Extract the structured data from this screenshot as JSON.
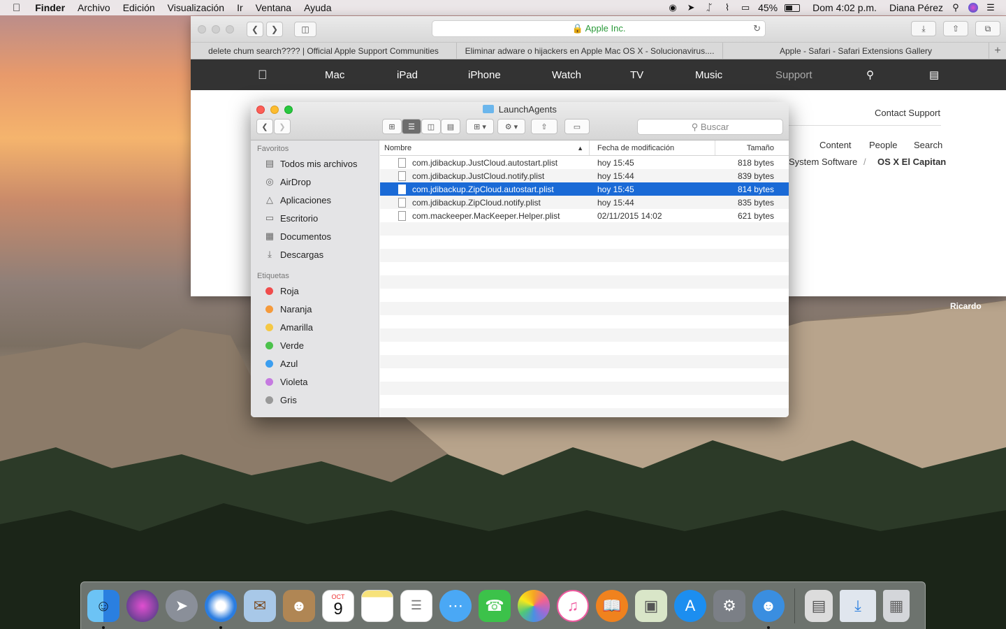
{
  "menubar": {
    "apple_icon": "apple-logo",
    "app": "Finder",
    "items": [
      "Archivo",
      "Edición",
      "Visualización",
      "Ir",
      "Ventana",
      "Ayuda"
    ],
    "battery": "45%",
    "clock": "Dom 4:02 p.m.",
    "user": "Diana Pérez"
  },
  "safari": {
    "address": "Apple Inc.",
    "tabs": [
      "delete chum search???? | Official Apple Support Communities",
      "Eliminar adware o hijackers en Apple Mac OS X - Solucionavirus....",
      "Apple - Safari - Safari Extensions Gallery"
    ],
    "nav": [
      "Mac",
      "iPad",
      "iPhone",
      "Watch",
      "TV",
      "Music",
      "Support"
    ],
    "content": {
      "contact": "Contact Support",
      "links": [
        "Content",
        "People",
        "Search"
      ],
      "crumb1": "System Software",
      "crumb_sep": "/",
      "crumb2": "OS X El Capitan"
    }
  },
  "finder": {
    "title": "LaunchAgents",
    "search_placeholder": "Buscar",
    "sidebar": {
      "favorites_label": "Favoritos",
      "favorites": [
        {
          "label": "Todos mis archivos",
          "icon": "all-files-icon"
        },
        {
          "label": "AirDrop",
          "icon": "airdrop-icon"
        },
        {
          "label": "Aplicaciones",
          "icon": "applications-icon"
        },
        {
          "label": "Escritorio",
          "icon": "desktop-icon"
        },
        {
          "label": "Documentos",
          "icon": "documents-icon"
        },
        {
          "label": "Descargas",
          "icon": "downloads-icon"
        }
      ],
      "tags_label": "Etiquetas",
      "tags": [
        {
          "label": "Roja",
          "color": "#f04c4c"
        },
        {
          "label": "Naranja",
          "color": "#f59a3b"
        },
        {
          "label": "Amarilla",
          "color": "#f5c844"
        },
        {
          "label": "Verde",
          "color": "#4cc24c"
        },
        {
          "label": "Azul",
          "color": "#3b9ef0"
        },
        {
          "label": "Violeta",
          "color": "#c57ae0"
        },
        {
          "label": "Gris",
          "color": "#999999"
        }
      ]
    },
    "columns": [
      "Nombre",
      "Fecha de modificación",
      "Tamaño"
    ],
    "files": [
      {
        "name": "com.jdibackup.JustCloud.autostart.plist",
        "date": "hoy 15:45",
        "size": "818 bytes"
      },
      {
        "name": "com.jdibackup.JustCloud.notify.plist",
        "date": "hoy 15:44",
        "size": "839 bytes"
      },
      {
        "name": "com.jdibackup.ZipCloud.autostart.plist",
        "date": "hoy 15:45",
        "size": "814 bytes"
      },
      {
        "name": "com.jdibackup.ZipCloud.notify.plist",
        "date": "hoy 15:44",
        "size": "835 bytes"
      },
      {
        "name": "com.mackeeper.MacKeeper.Helper.plist",
        "date": "02/11/2015 14:02",
        "size": "621 bytes"
      }
    ],
    "selected_index": 2
  },
  "desktop": {
    "label": "Ricardo"
  },
  "dock": {
    "calendar_month": "OCT",
    "calendar_day": "9",
    "items": [
      {
        "name": "finder-icon",
        "color": "#2a8be8"
      },
      {
        "name": "siri-icon",
        "color": "#3a3a7a"
      },
      {
        "name": "launchpad-icon",
        "color": "#8a8f99"
      },
      {
        "name": "safari-icon",
        "color": "#2b7de0"
      },
      {
        "name": "mail-icon",
        "color": "#a8c8e8"
      },
      {
        "name": "contacts-icon",
        "color": "#b08654"
      },
      {
        "name": "calendar-icon",
        "color": "#ffffff"
      },
      {
        "name": "notes-icon",
        "color": "#f7e27a"
      },
      {
        "name": "reminders-icon",
        "color": "#ffffff"
      },
      {
        "name": "messages-icon",
        "color": "#4aa8f5"
      },
      {
        "name": "facetime-icon",
        "color": "#3cc24a"
      },
      {
        "name": "photos-icon",
        "color": "#f0f0f0"
      },
      {
        "name": "itunes-icon",
        "color": "#f05aa0"
      },
      {
        "name": "ibooks-icon",
        "color": "#f0821e"
      },
      {
        "name": "preview-icon",
        "color": "#d9e6c8"
      },
      {
        "name": "app-store-icon",
        "color": "#1c8ef0"
      },
      {
        "name": "system-preferences-icon",
        "color": "#7b7f86"
      },
      {
        "name": "mackeeper-icon",
        "color": "#3a8ee0"
      },
      {
        "name": "trash-divider",
        "color": ""
      },
      {
        "name": "archive-utility-icon",
        "color": "#dcdcdc"
      },
      {
        "name": "downloads-stack-icon",
        "color": "#e0e6ee"
      },
      {
        "name": "trash-icon",
        "color": "#d4d6da"
      }
    ]
  }
}
